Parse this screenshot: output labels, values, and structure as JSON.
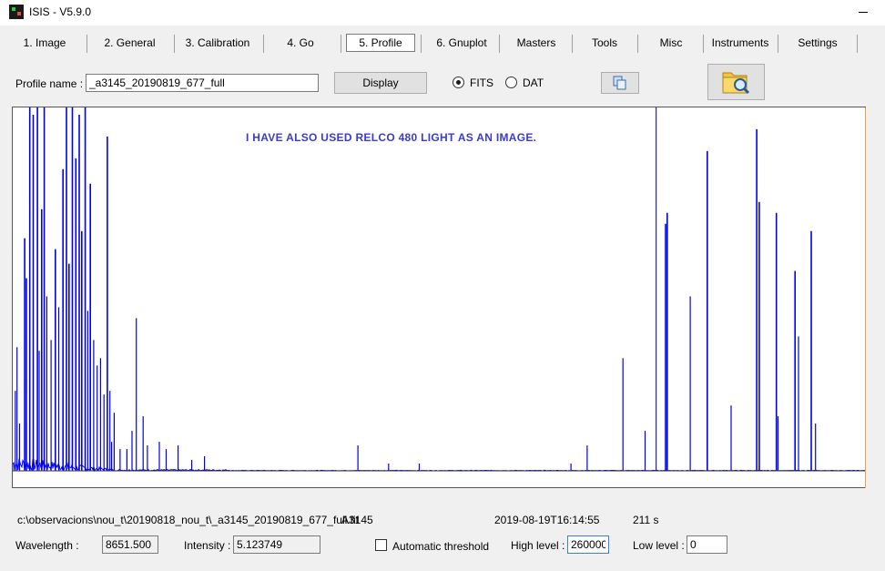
{
  "window": {
    "title": "ISIS - V5.9.0"
  },
  "tabs": [
    "1. Image",
    "2. General",
    "3. Calibration",
    "4. Go",
    "5. Profile",
    "6. Gnuplot",
    "Masters",
    "Tools",
    "Misc",
    "Instruments",
    "Settings"
  ],
  "active_tab": "5. Profile",
  "profile": {
    "label": "Profile name :",
    "value": "_a3145_20190819_677_full",
    "display_label": "Display",
    "format_fits": "FITS",
    "format_dat": "DAT",
    "selected_format": "FITS"
  },
  "annotation": "I HAVE ALSO USED RELCO 480 LIGHT AS AN IMAGE.",
  "colors": {
    "spectrum": "#0000ee",
    "annotation": "#3b3bd0",
    "marker": "#000055"
  },
  "icons": {
    "copy": "copy-icon",
    "open": "folder-magnifier-icon"
  },
  "status": {
    "path": "c:\\observacions\\nou_t\\20190818_nou_t\\_a3145_20190819_677_full.fit",
    "object": "A3145",
    "date": "2019-08-19T16:14:55",
    "exposure": "211 s"
  },
  "readout": {
    "wavelength_label": "Wavelength :",
    "wavelength": "8651.500",
    "intensity_label": "Intensity :",
    "intensity": "5.123749",
    "auto_threshold_label": "Automatic threshold",
    "auto_threshold": false,
    "high_label": "High level :",
    "high_value": "260000",
    "low_label": "Low level :",
    "low_value": "0"
  },
  "chart_data": {
    "type": "line",
    "title": "",
    "xlabel": "",
    "ylabel": "",
    "xlim": [
      0,
      1
    ],
    "ylim": [
      0,
      260000
    ],
    "baseline": 5200,
    "cursor_x": 0.755,
    "series": [
      {
        "values": [
          [
            0.003,
            0.22
          ],
          [
            0.005,
            0.34
          ],
          [
            0.008,
            0.13
          ],
          [
            0.014,
            0.64
          ],
          [
            0.016,
            0.53
          ],
          [
            0.02,
            1.02
          ],
          [
            0.024,
            0.98
          ],
          [
            0.029,
            1.02
          ],
          [
            0.031,
            0.33
          ],
          [
            0.034,
            0.72
          ],
          [
            0.037,
            1.02
          ],
          [
            0.04,
            0.48
          ],
          [
            0.045,
            0.36
          ],
          [
            0.05,
            0.61
          ],
          [
            0.054,
            0.45
          ],
          [
            0.059,
            0.83
          ],
          [
            0.063,
            1.02
          ],
          [
            0.066,
            0.57
          ],
          [
            0.07,
            1.02
          ],
          [
            0.074,
            0.86
          ],
          [
            0.078,
            0.98
          ],
          [
            0.081,
            0.66
          ],
          [
            0.085,
            1.02
          ],
          [
            0.088,
            0.44
          ],
          [
            0.091,
            0.79
          ],
          [
            0.095,
            0.36
          ],
          [
            0.099,
            0.29
          ],
          [
            0.103,
            0.31
          ],
          [
            0.107,
            0.21
          ],
          [
            0.111,
            0.92
          ],
          [
            0.114,
            0.22
          ],
          [
            0.116,
            0.08
          ],
          [
            0.119,
            0.16
          ],
          [
            0.126,
            0.06
          ],
          [
            0.134,
            0.06
          ],
          [
            0.14,
            0.11
          ],
          [
            0.145,
            0.42
          ],
          [
            0.153,
            0.15
          ],
          [
            0.158,
            0.07
          ],
          [
            0.172,
            0.08
          ],
          [
            0.18,
            0.06
          ],
          [
            0.194,
            0.07
          ],
          [
            0.21,
            0.03
          ],
          [
            0.225,
            0.04
          ],
          [
            0.405,
            0.07
          ],
          [
            0.441,
            0.02
          ],
          [
            0.477,
            0.02
          ],
          [
            0.655,
            0.02
          ],
          [
            0.674,
            0.07
          ],
          [
            0.716,
            0.31
          ],
          [
            0.742,
            0.11
          ],
          [
            0.766,
            0.68
          ],
          [
            0.768,
            0.71
          ],
          [
            0.795,
            0.48
          ],
          [
            0.815,
            0.88
          ],
          [
            0.843,
            0.18
          ],
          [
            0.873,
            0.94
          ],
          [
            0.876,
            0.74
          ],
          [
            0.896,
            0.71
          ],
          [
            0.898,
            0.15
          ],
          [
            0.918,
            0.55
          ],
          [
            0.922,
            0.37
          ],
          [
            0.937,
            0.66
          ],
          [
            0.942,
            0.13
          ]
        ]
      }
    ]
  }
}
